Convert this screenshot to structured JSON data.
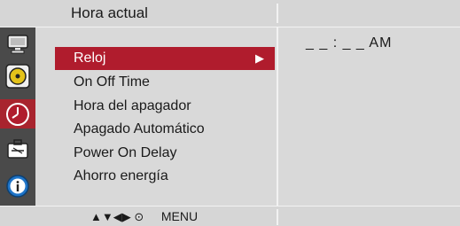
{
  "header": {
    "title": "Hora actual"
  },
  "sidebar": {
    "icons": [
      {
        "name": "monitor-icon"
      },
      {
        "name": "disc-icon"
      },
      {
        "name": "clock-icon",
        "active": true
      },
      {
        "name": "toolbox-icon"
      },
      {
        "name": "info-icon"
      }
    ]
  },
  "menu": {
    "items": [
      {
        "label": "Reloj",
        "selected": true,
        "arrow": "▶"
      },
      {
        "label": "On Off Time"
      },
      {
        "label": "Hora del apagador"
      },
      {
        "label": "Apagado Automático"
      },
      {
        "label": "Power On Delay"
      },
      {
        "label": "Ahorro energía"
      }
    ]
  },
  "value_panel": {
    "time": "_ _ : _ _",
    "ampm": "AM"
  },
  "footer": {
    "nav_symbols": "▲▼◀▶ ⊙",
    "menu_label": "MENU"
  },
  "colors": {
    "accent": "#b01c2d",
    "icon_bg": "#4a4a4a",
    "panel_bg": "#d9d9d9"
  }
}
